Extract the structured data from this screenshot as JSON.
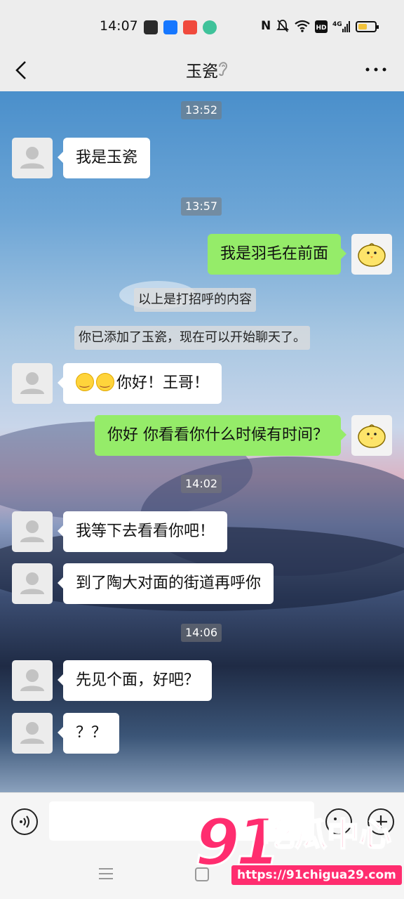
{
  "status_bar": {
    "time": "14:07",
    "network_label": "4G",
    "app_icons": [
      "soul-app-icon",
      "alipay-icon",
      "video-app-icon",
      "message-app-icon"
    ],
    "system_icons": [
      "nfc-icon",
      "mute-icon",
      "wifi-icon",
      "hd-icon",
      "signal-icon",
      "battery-icon"
    ]
  },
  "header": {
    "title": "玉瓷",
    "back_icon": "chevron-left-icon",
    "ear_icon": "ear-icon",
    "more_icon": "more-dots-icon"
  },
  "chat": {
    "timestamps": [
      "13:52",
      "13:57",
      "14:02",
      "14:06"
    ],
    "system_notices": [
      "以上是打招呼的内容",
      "你已添加了玉瓷，现在可以开始聊天了。"
    ],
    "messages": [
      {
        "side": "left",
        "text": "我是玉瓷"
      },
      {
        "side": "right",
        "text": "我是羽毛在前面"
      },
      {
        "side": "left",
        "text": "你好！王哥！",
        "emoji_count": 2
      },
      {
        "side": "right",
        "text": "你好 你看看你什么时候有时间？"
      },
      {
        "side": "left",
        "text": "我等下去看看你吧！"
      },
      {
        "side": "left",
        "text": "到了陶大对面的街道再呼你"
      },
      {
        "side": "left",
        "text": "先见个面，好吧？"
      },
      {
        "side": "left",
        "text": "？？"
      }
    ]
  },
  "input_bar": {
    "placeholder": "",
    "voice_icon": "voice-icon",
    "emoji_icon": "emoji-icon",
    "plus_icon": "plus-icon"
  },
  "watermark": {
    "number": "91",
    "text": "吃瓜中心",
    "url": "https://91chigua29.com"
  },
  "colors": {
    "sent_bubble": "#95ec69",
    "received_bubble": "#ffffff",
    "watermark": "#ff2d6f"
  }
}
